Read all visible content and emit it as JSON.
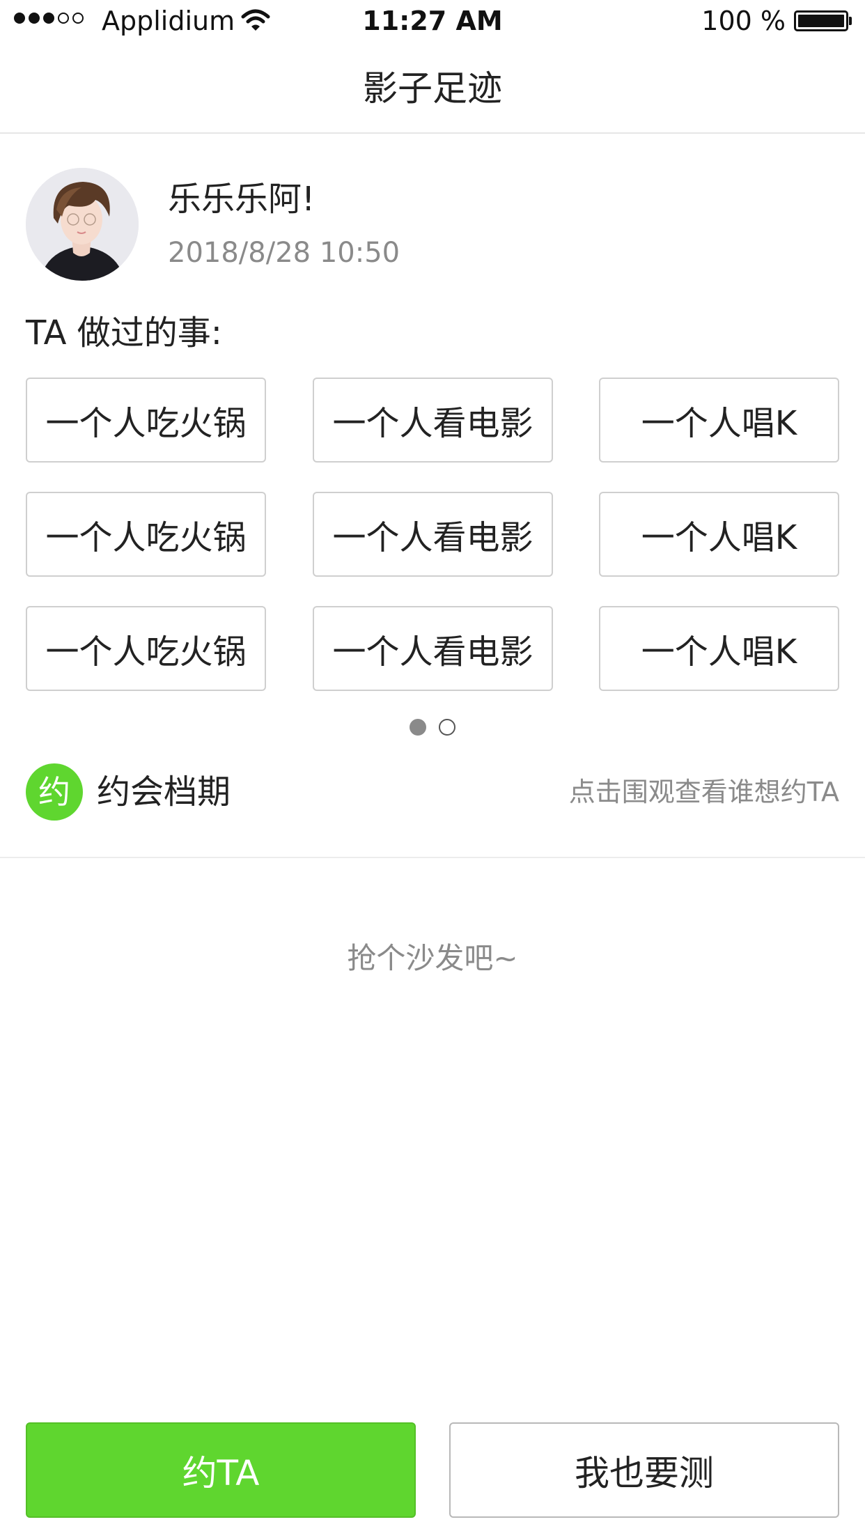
{
  "status_bar": {
    "signal_filled": 3,
    "signal_total": 5,
    "carrier": "Applidium",
    "time": "11:27 AM",
    "battery": "100 %",
    "battery_level": 1.0
  },
  "nav": {
    "title": "影子足迹"
  },
  "profile": {
    "name": "乐乐乐阿!",
    "time": "2018/8/28  10:50"
  },
  "activities": {
    "label": "TA 做过的事:",
    "items": [
      "一个人吃火锅",
      "一个人看电影",
      "一个人唱K",
      "一个人吃火锅",
      "一个人看电影",
      "一个人唱K",
      "一个人吃火锅",
      "一个人看电影",
      "一个人唱K"
    ],
    "page_current": 1,
    "page_total": 2
  },
  "schedule": {
    "badge": "约",
    "title": "约会档期",
    "link": "点击围观查看谁想约TA"
  },
  "comments": {
    "empty_text": "抢个沙发吧~"
  },
  "actions": {
    "date_label": "约TA",
    "test_label": "我也要测"
  },
  "colors": {
    "accent": "#5fd62f",
    "secondary_text": "#8a8a8a",
    "border": "#cfcfcf"
  },
  "icons": [
    "wifi-icon",
    "battery-icon",
    "avatar"
  ]
}
